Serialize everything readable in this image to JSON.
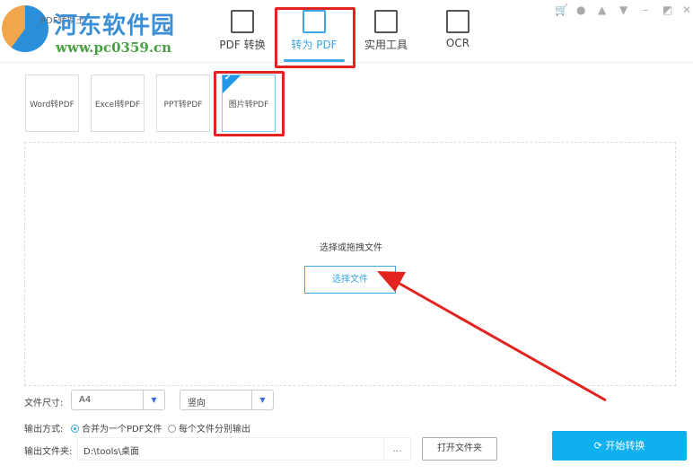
{
  "header": {
    "app_name": "PDF转换王",
    "watermark_title": "河东软件园",
    "watermark_url": "www.pc0359.cn",
    "tabs": [
      {
        "label": "PDF 转换",
        "icon": "pdf-convert-icon"
      },
      {
        "label": "转为 PDF",
        "icon": "to-pdf-icon",
        "active": true
      },
      {
        "label": "实用工具",
        "icon": "tools-icon"
      },
      {
        "label": "OCR",
        "icon": "ocr-icon"
      }
    ],
    "window_controls": [
      "cart-icon",
      "user-icon",
      "bell-icon",
      "menu-icon",
      "minimize-icon",
      "restore-icon",
      "close-icon"
    ]
  },
  "cards": [
    {
      "label": "Word转PDF"
    },
    {
      "label": "Excel转PDF"
    },
    {
      "label": "PPT转PDF"
    },
    {
      "label": "图片转PDF",
      "active": true
    }
  ],
  "drop": {
    "hint": "选择或拖拽文件",
    "button": "选择文件"
  },
  "options": {
    "size_label": "文件尺寸:",
    "size_value": "A4",
    "orientation_value": "竖向",
    "output_mode_label": "输出方式:",
    "mode_merge": "合并为一个PDF文件",
    "mode_separate": "每个文件分别输出",
    "folder_label": "输出文件夹:",
    "folder_value": "D:\\tools\\桌面",
    "browse": "...",
    "open_folder": "打开文件夹",
    "start": "开始转换"
  },
  "colors": {
    "accent": "#3aa7e8",
    "start_button": "#0fb0f0",
    "highlight": "#e3231f"
  }
}
